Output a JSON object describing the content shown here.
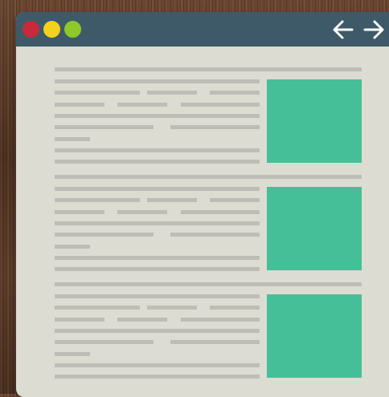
{
  "window": {
    "controls": [
      "close",
      "minimize",
      "maximize"
    ],
    "nav": {
      "back_icon": "arrow-left-icon",
      "forward_icon": "arrow-right-icon"
    }
  },
  "colors": {
    "titlebar": "#3e5a68",
    "window_bg": "#dcdcd2",
    "text_placeholder": "#bdbdb8",
    "image_placeholder": "#45bf98",
    "close": "#c72a3a",
    "minimize": "#f2d21c",
    "maximize": "#8ec82a"
  },
  "articles": [
    {
      "image": "image-placeholder"
    },
    {
      "image": "image-placeholder"
    },
    {
      "image": "image-placeholder"
    }
  ]
}
